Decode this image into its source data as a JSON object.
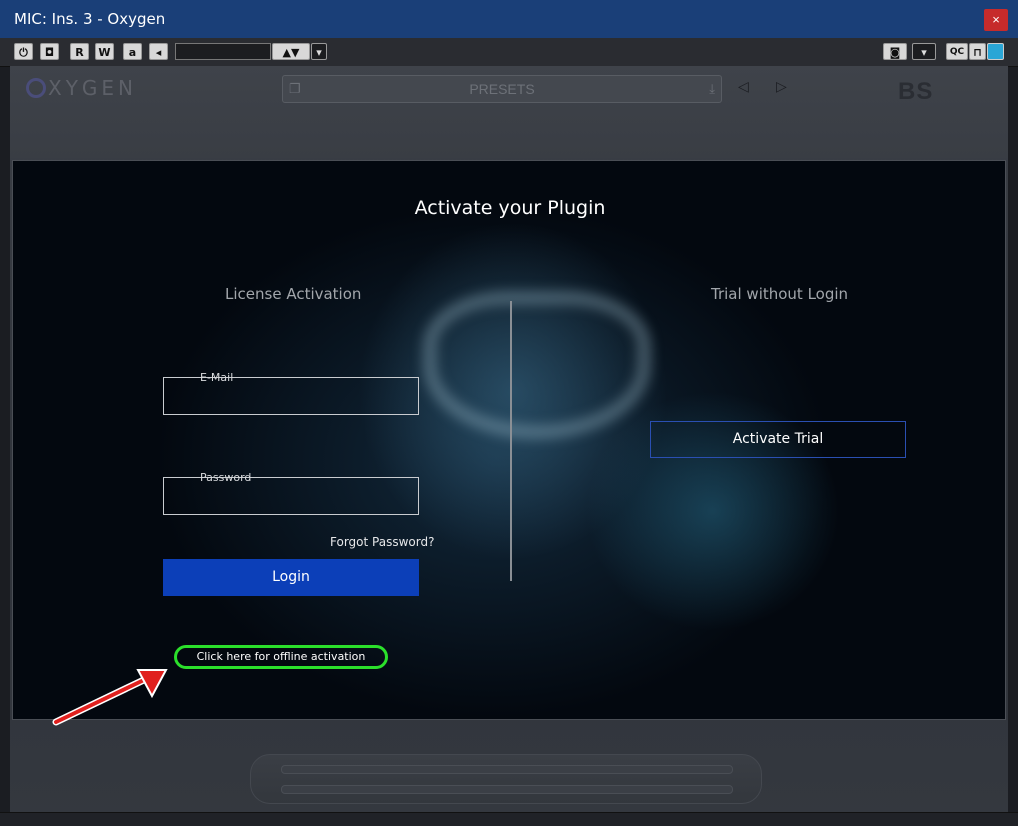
{
  "window": {
    "title": "MIC: Ins. 3 - Oxygen",
    "close_label": "×"
  },
  "toolbar": {
    "buttons": [
      {
        "name": "power-button",
        "label": "⏻"
      },
      {
        "name": "bypass-button",
        "label": "◘"
      },
      {
        "name": "read-button",
        "label": "R"
      },
      {
        "name": "write-button",
        "label": "W"
      },
      {
        "name": "auto-button",
        "label": "a"
      },
      {
        "name": "back-button",
        "label": "◂"
      }
    ],
    "up_down_label": "▲▼",
    "dropdown_label": "▾",
    "right": {
      "camera_label": "◙",
      "menu_label": "▾",
      "qc_label": "QC",
      "lock_label": "⊓"
    }
  },
  "plugin": {
    "logo_text": "XYGEN",
    "presets_label": "PRESETS",
    "presets_left_icon": "❐",
    "presets_right_icon": "⤓",
    "prev_label": "◁",
    "next_label": "▷",
    "brand_label": "BS"
  },
  "dialog": {
    "title": "Activate your Plugin",
    "license_title": "License Activation",
    "trial_title": "Trial without Login",
    "email_label": "E-Mail",
    "password_label": "Password",
    "forgot_label": "Forgot Password?",
    "login_label": "Login",
    "trial_button_label": "Activate Trial",
    "offline_label": "Click here for offline activation"
  }
}
